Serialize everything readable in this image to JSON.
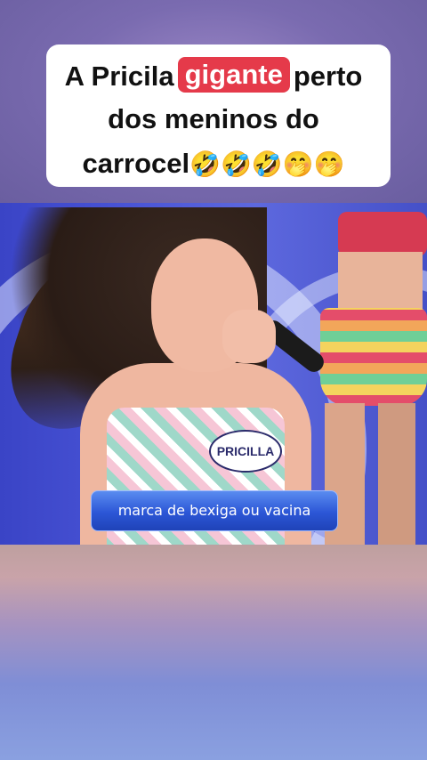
{
  "caption": {
    "line1_before": "A Pricila",
    "highlight": "gigante",
    "line1_after": "perto",
    "line2": "dos meninos do",
    "line3_text": "carrocel",
    "line3_emojis": "🤣🤣🤣🤭🤭",
    "highlight_color": "#e53a4a"
  },
  "video": {
    "name_tag": "PRICILLA",
    "subtitle": "marca de bexiga ou vacina"
  }
}
